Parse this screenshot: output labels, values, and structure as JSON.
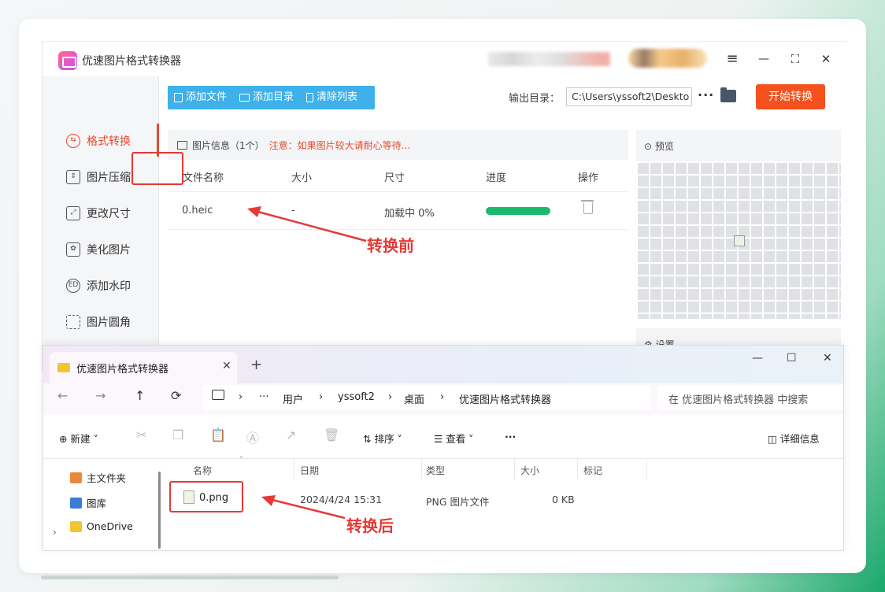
{
  "app": {
    "title": "优速图片格式转换器",
    "window_controls": {
      "menu": "≡",
      "minimize": "—",
      "maximize": "⛶",
      "close": "✕"
    },
    "sidebar": {
      "items": [
        {
          "label": "格式转换",
          "icon": "format-convert-icon",
          "active": true
        },
        {
          "label": "图片压缩",
          "icon": "compress-icon"
        },
        {
          "label": "更改尺寸",
          "icon": "resize-icon"
        },
        {
          "label": "美化图片",
          "icon": "beautify-icon"
        },
        {
          "label": "添加水印",
          "icon": "watermark-icon"
        },
        {
          "label": "图片圆角",
          "icon": "round-corner-icon"
        }
      ]
    },
    "toolbar": {
      "add_file": "添加文件",
      "add_dir": "添加目录",
      "clear_list": "清除列表"
    },
    "output": {
      "label": "输出目录：",
      "path": "C:\\Users\\yssoft2\\Deskto",
      "more": "···"
    },
    "start_button": "开始转换",
    "info": {
      "title": "图片信息（1个）",
      "warning": "注意：如果图片较大请耐心等待..."
    },
    "table": {
      "headers": [
        "文件名称",
        "大小",
        "尺寸",
        "进度",
        "操作"
      ],
      "rows": [
        {
          "name": "0.heic",
          "size": "-",
          "dims": "加载中 0%",
          "progress": 1.0
        }
      ]
    },
    "preview": {
      "title": "预览"
    },
    "settings": {
      "title": "设置"
    },
    "accent": "#e64a2e",
    "toolbar_color": "#3eb0ea",
    "progress_color": "#1db96a"
  },
  "annotations": {
    "before": "转换前",
    "after": "转换后"
  },
  "explorer": {
    "tab_title": "优速图片格式转换器",
    "tab_close": "✕",
    "new_tab": "+",
    "window_controls": {
      "minimize": "—",
      "maximize": "☐",
      "close": "✕"
    },
    "nav": {
      "back": "←",
      "forward": "→",
      "up": "↑",
      "refresh": "⟳"
    },
    "breadcrumb": [
      "用户",
      "yssoft2",
      "桌面",
      "优速图片格式转换器"
    ],
    "breadcrumb_more": "···",
    "search_placeholder": "在 优速图片格式转换器 中搜索",
    "commands": {
      "new": "新建",
      "sort": "排序",
      "view": "查看",
      "more": "···",
      "details": "详细信息"
    },
    "nav_pane": [
      {
        "label": "主文件夹",
        "icon": "home-icon"
      },
      {
        "label": "图库",
        "icon": "gallery-icon"
      },
      {
        "label": "OneDrive",
        "icon": "onedrive-folder-icon"
      }
    ],
    "columns": [
      "名称",
      "日期",
      "类型",
      "大小",
      "标记"
    ],
    "files": [
      {
        "name": "0.png",
        "date": "2024/4/24 15:31",
        "type": "PNG 图片文件",
        "size": "0 KB"
      }
    ]
  }
}
